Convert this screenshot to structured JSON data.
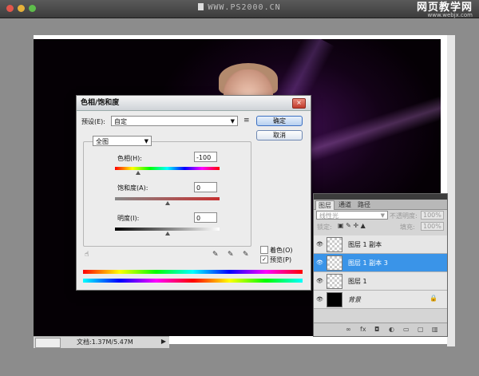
{
  "window": {
    "title": "WWW.PS2000.CN",
    "watermark_main": "网页教学网",
    "watermark_sub": "www.webjx.com"
  },
  "statusbar": {
    "text": "文档:1.37M/5.47M"
  },
  "hue_dialog": {
    "title": "色相/饱和度",
    "preset_label": "预设(E):",
    "preset_value": "自定",
    "ok": "确定",
    "cancel": "取消",
    "channel": "全图",
    "hue_label": "色相(H):",
    "hue_value": "-100",
    "sat_label": "饱和度(A):",
    "sat_value": "0",
    "light_label": "明度(I):",
    "light_value": "0",
    "colorize_label": "着色(O)",
    "colorize_checked": false,
    "preview_label": "预览(P)",
    "preview_checked": true,
    "hue_position": 0.22
  },
  "layers_panel": {
    "tabs": [
      "图层",
      "通道",
      "路径"
    ],
    "blend_mode": "线性光",
    "opacity_label": "不透明度:",
    "opacity_value": "100%",
    "lock_label": "锁定:",
    "fill_label": "填充:",
    "fill_value": "100%",
    "layers": [
      {
        "name": "图层 1 副本",
        "selected": false,
        "dark": false,
        "locked": false
      },
      {
        "name": "图层 1 副本 3",
        "selected": true,
        "dark": false,
        "locked": false
      },
      {
        "name": "图层 1",
        "selected": false,
        "dark": false,
        "locked": false
      },
      {
        "name": "背景",
        "selected": false,
        "dark": true,
        "locked": true
      }
    ]
  }
}
